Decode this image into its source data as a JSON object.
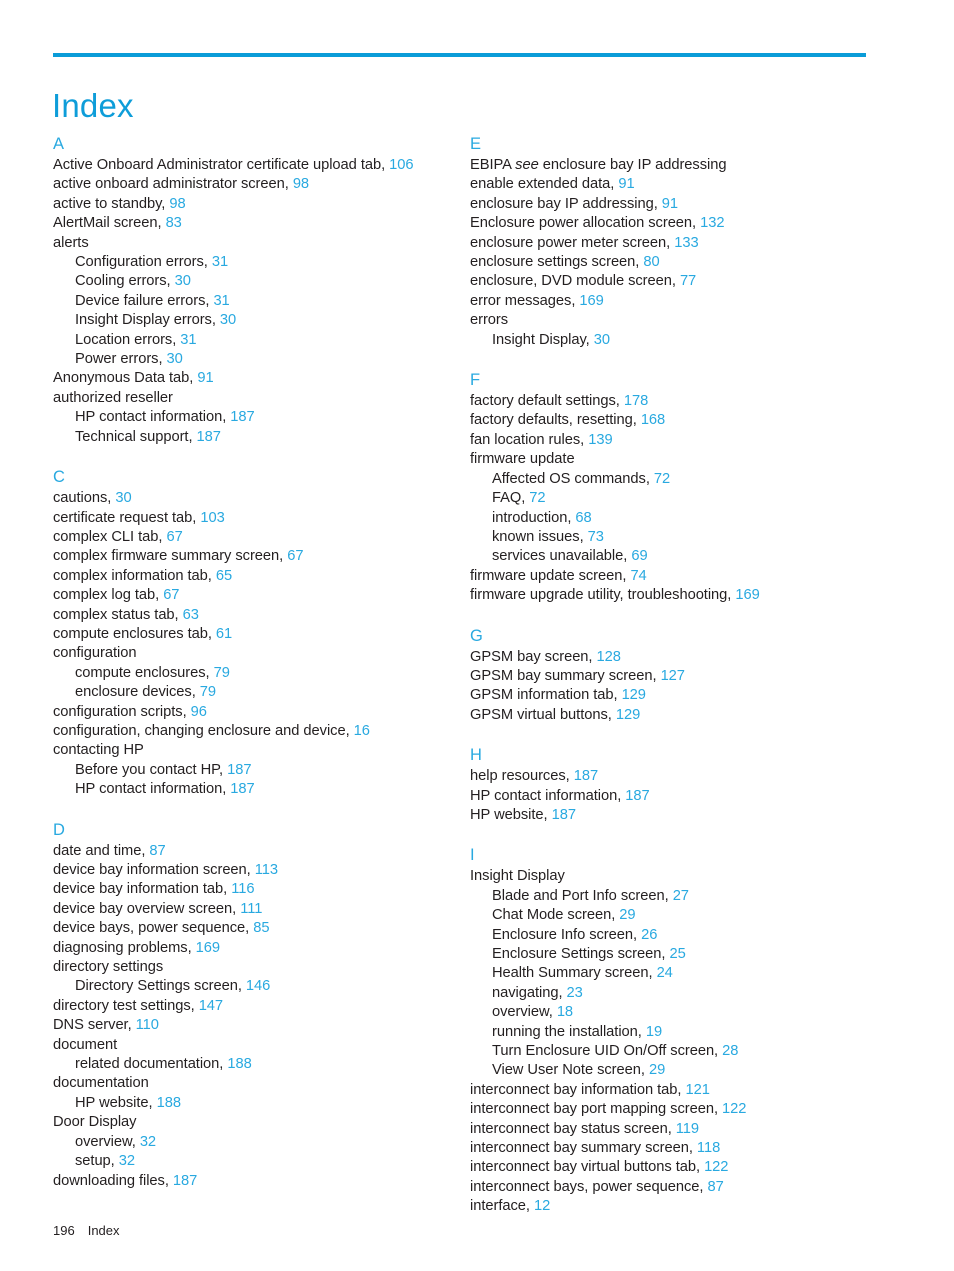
{
  "document": {
    "title": "Index",
    "accent_rule_color": "#0a9cd8",
    "title_color": "#0e9dd9",
    "page_number_color": "#29a9e0",
    "text_color": "#231f20"
  },
  "footer": {
    "page_number": "196",
    "label": "Index"
  },
  "left_column": [
    {
      "letter": "A",
      "entries": [
        {
          "text": "Active Onboard Administrator certificate upload tab,",
          "page": "106",
          "level": 0
        },
        {
          "text": "active onboard administrator screen,",
          "page": "98",
          "level": 0
        },
        {
          "text": "active to standby,",
          "page": "98",
          "level": 0
        },
        {
          "text": "AlertMail screen,",
          "page": "83",
          "level": 0
        },
        {
          "text": "alerts",
          "page": "",
          "level": 0
        },
        {
          "text": "Configuration errors,",
          "page": "31",
          "level": 1
        },
        {
          "text": "Cooling errors,",
          "page": "30",
          "level": 1
        },
        {
          "text": "Device failure errors,",
          "page": "31",
          "level": 1
        },
        {
          "text": "Insight Display errors,",
          "page": "30",
          "level": 1
        },
        {
          "text": "Location errors,",
          "page": "31",
          "level": 1
        },
        {
          "text": "Power errors,",
          "page": "30",
          "level": 1
        },
        {
          "text": "Anonymous Data tab,",
          "page": "91",
          "level": 0
        },
        {
          "text": "authorized reseller",
          "page": "",
          "level": 0
        },
        {
          "text": "HP contact information,",
          "page": "187",
          "level": 1
        },
        {
          "text": "Technical support,",
          "page": "187",
          "level": 1
        }
      ]
    },
    {
      "letter": "C",
      "entries": [
        {
          "text": "cautions,",
          "page": "30",
          "level": 0
        },
        {
          "text": "certificate request tab,",
          "page": "103",
          "level": 0
        },
        {
          "text": "complex CLI tab,",
          "page": "67",
          "level": 0
        },
        {
          "text": "complex firmware summary screen,",
          "page": "67",
          "level": 0
        },
        {
          "text": "complex information tab,",
          "page": "65",
          "level": 0
        },
        {
          "text": "complex log tab,",
          "page": "67",
          "level": 0
        },
        {
          "text": "complex status tab,",
          "page": "63",
          "level": 0
        },
        {
          "text": "compute enclosures tab,",
          "page": "61",
          "level": 0
        },
        {
          "text": "configuration",
          "page": "",
          "level": 0
        },
        {
          "text": "compute enclosures,",
          "page": "79",
          "level": 1
        },
        {
          "text": "enclosure devices,",
          "page": "79",
          "level": 1
        },
        {
          "text": "configuration scripts,",
          "page": "96",
          "level": 0
        },
        {
          "text": "configuration, changing enclosure and device,",
          "page": "16",
          "level": 0
        },
        {
          "text": "contacting HP",
          "page": "",
          "level": 0
        },
        {
          "text": "Before you contact HP,",
          "page": "187",
          "level": 1
        },
        {
          "text": "HP contact information,",
          "page": "187",
          "level": 1
        }
      ]
    },
    {
      "letter": "D",
      "entries": [
        {
          "text": "date and time,",
          "page": "87",
          "level": 0
        },
        {
          "text": "device bay information screen,",
          "page": "113",
          "level": 0
        },
        {
          "text": "device bay information tab,",
          "page": "116",
          "level": 0
        },
        {
          "text": "device bay overview screen,",
          "page": "111",
          "level": 0
        },
        {
          "text": "device bays, power sequence,",
          "page": "85",
          "level": 0
        },
        {
          "text": "diagnosing problems,",
          "page": "169",
          "level": 0
        },
        {
          "text": "directory settings",
          "page": "",
          "level": 0
        },
        {
          "text": "Directory Settings screen,",
          "page": "146",
          "level": 1
        },
        {
          "text": "directory test settings,",
          "page": "147",
          "level": 0
        },
        {
          "text": "DNS server,",
          "page": "110",
          "level": 0
        },
        {
          "text": "document",
          "page": "",
          "level": 0
        },
        {
          "text": "related documentation,",
          "page": "188",
          "level": 1
        },
        {
          "text": "documentation",
          "page": "",
          "level": 0
        },
        {
          "text": "HP website,",
          "page": "188",
          "level": 1
        },
        {
          "text": "Door Display",
          "page": "",
          "level": 0
        },
        {
          "text": "overview,",
          "page": "32",
          "level": 1
        },
        {
          "text": "setup,",
          "page": "32",
          "level": 1
        },
        {
          "text": "downloading files,",
          "page": "187",
          "level": 0
        }
      ]
    }
  ],
  "right_column": [
    {
      "letter": "E",
      "entries": [
        {
          "text": "EBIPA ",
          "italic": "see",
          "text_after": " enclosure bay IP addressing",
          "page": "",
          "level": 0
        },
        {
          "text": "enable extended data,",
          "page": "91",
          "level": 0
        },
        {
          "text": "enclosure bay IP addressing,",
          "page": "91",
          "level": 0
        },
        {
          "text": "Enclosure power allocation screen,",
          "page": "132",
          "level": 0
        },
        {
          "text": "enclosure power meter screen,",
          "page": "133",
          "level": 0
        },
        {
          "text": "enclosure settings screen,",
          "page": "80",
          "level": 0
        },
        {
          "text": "enclosure, DVD module screen,",
          "page": "77",
          "level": 0
        },
        {
          "text": "error messages,",
          "page": "169",
          "level": 0
        },
        {
          "text": "errors",
          "page": "",
          "level": 0
        },
        {
          "text": "Insight Display,",
          "page": "30",
          "level": 1
        }
      ]
    },
    {
      "letter": "F",
      "entries": [
        {
          "text": "factory default settings,",
          "page": "178",
          "level": 0
        },
        {
          "text": "factory defaults, resetting,",
          "page": "168",
          "level": 0
        },
        {
          "text": "fan location rules,",
          "page": "139",
          "level": 0
        },
        {
          "text": "firmware update",
          "page": "",
          "level": 0
        },
        {
          "text": "Affected OS commands,",
          "page": "72",
          "level": 1
        },
        {
          "text": "FAQ,",
          "page": "72",
          "level": 1
        },
        {
          "text": "introduction,",
          "page": "68",
          "level": 1
        },
        {
          "text": "known issues,",
          "page": "73",
          "level": 1
        },
        {
          "text": "services unavailable,",
          "page": "69",
          "level": 1
        },
        {
          "text": "firmware update screen,",
          "page": "74",
          "level": 0
        },
        {
          "text": "firmware upgrade utility, troubleshooting,",
          "page": "169",
          "level": 0
        }
      ]
    },
    {
      "letter": "G",
      "entries": [
        {
          "text": "GPSM bay screen,",
          "page": "128",
          "level": 0
        },
        {
          "text": "GPSM bay summary screen,",
          "page": "127",
          "level": 0
        },
        {
          "text": "GPSM information tab,",
          "page": "129",
          "level": 0
        },
        {
          "text": "GPSM virtual buttons,",
          "page": "129",
          "level": 0
        }
      ]
    },
    {
      "letter": "H",
      "entries": [
        {
          "text": "help resources,",
          "page": "187",
          "level": 0
        },
        {
          "text": "HP contact information,",
          "page": "187",
          "level": 0
        },
        {
          "text": "HP website,",
          "page": "187",
          "level": 0
        }
      ]
    },
    {
      "letter": "I",
      "entries": [
        {
          "text": "Insight Display",
          "page": "",
          "level": 0
        },
        {
          "text": "Blade and Port Info screen,",
          "page": "27",
          "level": 1
        },
        {
          "text": "Chat Mode screen,",
          "page": "29",
          "level": 1
        },
        {
          "text": "Enclosure Info screen,",
          "page": "26",
          "level": 1
        },
        {
          "text": "Enclosure Settings screen,",
          "page": "25",
          "level": 1
        },
        {
          "text": "Health Summary screen,",
          "page": "24",
          "level": 1
        },
        {
          "text": "navigating,",
          "page": "23",
          "level": 1
        },
        {
          "text": "overview,",
          "page": "18",
          "level": 1
        },
        {
          "text": "running the installation,",
          "page": "19",
          "level": 1
        },
        {
          "text": "Turn Enclosure UID On/Off screen,",
          "page": "28",
          "level": 1
        },
        {
          "text": "View User Note screen,",
          "page": "29",
          "level": 1
        },
        {
          "text": "interconnect bay information tab,",
          "page": "121",
          "level": 0
        },
        {
          "text": "interconnect bay port mapping screen,",
          "page": "122",
          "level": 0
        },
        {
          "text": "interconnect bay status screen,",
          "page": "119",
          "level": 0
        },
        {
          "text": "interconnect bay summary screen,",
          "page": "118",
          "level": 0
        },
        {
          "text": "interconnect bay virtual buttons tab,",
          "page": "122",
          "level": 0
        },
        {
          "text": "interconnect bays, power sequence,",
          "page": "87",
          "level": 0
        },
        {
          "text": "interface,",
          "page": "12",
          "level": 0
        }
      ]
    }
  ]
}
